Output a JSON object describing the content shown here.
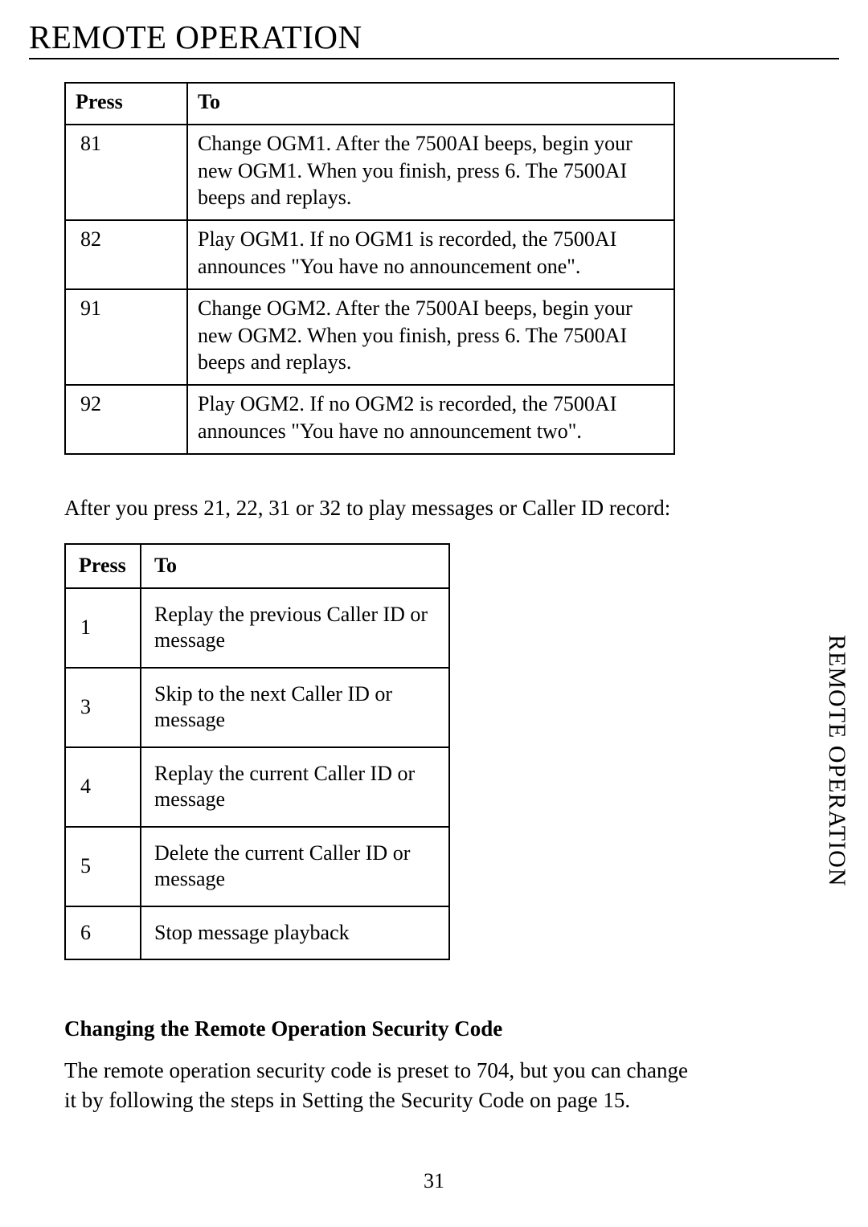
{
  "header": {
    "title": "REMOTE OPERATION"
  },
  "table1": {
    "headers": {
      "press": "Press",
      "to": "To"
    },
    "rows": [
      {
        "press": "81",
        "to": "Change OGM1.  After the 7500AI beeps, begin your new OGM1.  When you finish, press 6.  The 7500AI beeps and replays."
      },
      {
        "press": "82",
        "to": "Play OGM1.  If no OGM1 is recorded, the 7500AI announces \"You have  no announcement one\"."
      },
      {
        "press": "91",
        "to": "Change OGM2.  After the 7500AI beeps, begin your new OGM2.  When you finish, press 6.  The 7500AI beeps and replays."
      },
      {
        "press": "92",
        "to": "Play OGM2.  If no OGM2 is recorded, the 7500AI announces \"You have no announcement two\"."
      }
    ]
  },
  "midtext": "After you press 21, 22, 31 or 32 to play messages or Caller ID record:",
  "table2": {
    "headers": {
      "press": "Press",
      "to": "To"
    },
    "rows": [
      {
        "press": "1",
        "to": "Replay the previous Caller ID or message"
      },
      {
        "press": "3",
        "to": "Skip to the next Caller ID or message"
      },
      {
        "press": "4",
        "to": "Replay the current Caller ID or message"
      },
      {
        "press": "5",
        "to": "Delete the current Caller ID or message"
      },
      {
        "press": "6",
        "to": "Stop message playback"
      }
    ]
  },
  "section": {
    "heading": "Changing the Remote Operation Security Code",
    "body": "The remote operation security code is preset to 704, but you can change it by following the steps in Setting the Security Code on page 15."
  },
  "side_tab": "REMOTE OPERATION",
  "page_number": "31"
}
